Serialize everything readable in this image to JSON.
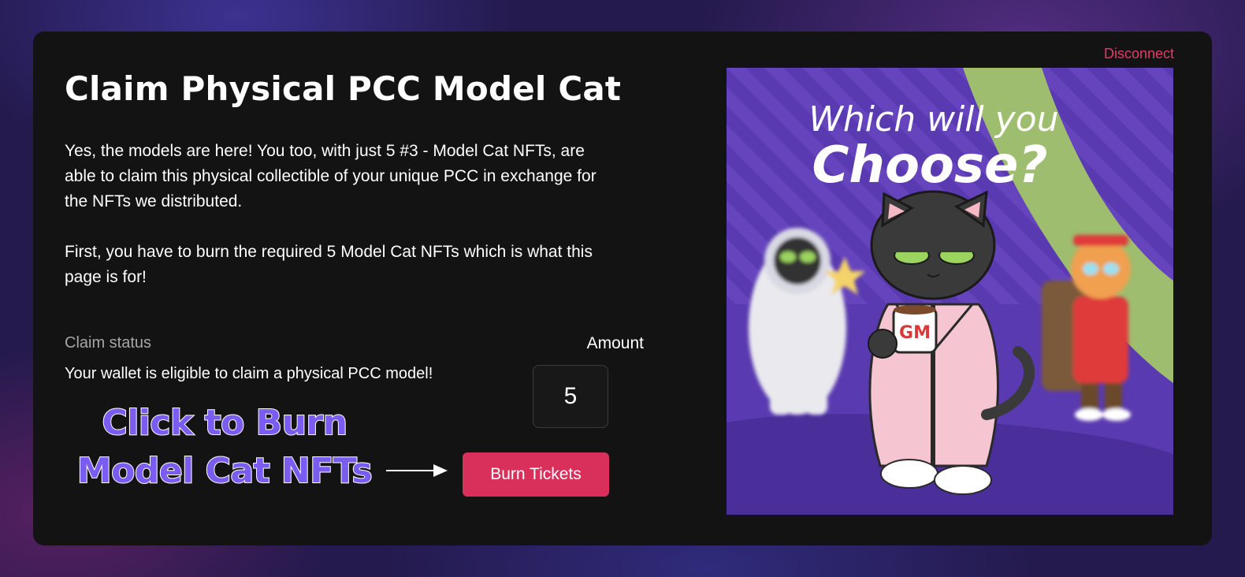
{
  "header": {
    "title": "Claim Physical PCC Model Cat",
    "disconnect_label": "Disconnect"
  },
  "description": {
    "paragraph1": "Yes, the models are here! You too, with just 5 #3 - Model Cat NFTs, are able to claim this physical collectible of your unique PCC in exchange for the NFTs we distributed.",
    "paragraph2": "First, you have to burn the required 5 Model Cat NFTs which is what this page is for!"
  },
  "claim": {
    "status_label": "Claim status",
    "status_text": "Your wallet is eligible to claim a physical PCC model!",
    "amount_label": "Amount",
    "amount_value": "5",
    "burn_button_label": "Burn Tickets"
  },
  "annotation": {
    "line1": "Click to Burn",
    "line2": "Model Cat NFTs"
  },
  "artwork": {
    "line1": "Which will you",
    "line2": "Choose?",
    "mug_text": "GM"
  },
  "colors": {
    "accent": "#d8305a",
    "disconnect": "#e23c6a",
    "annotation": "#7b5cf0",
    "card": "#131313"
  }
}
